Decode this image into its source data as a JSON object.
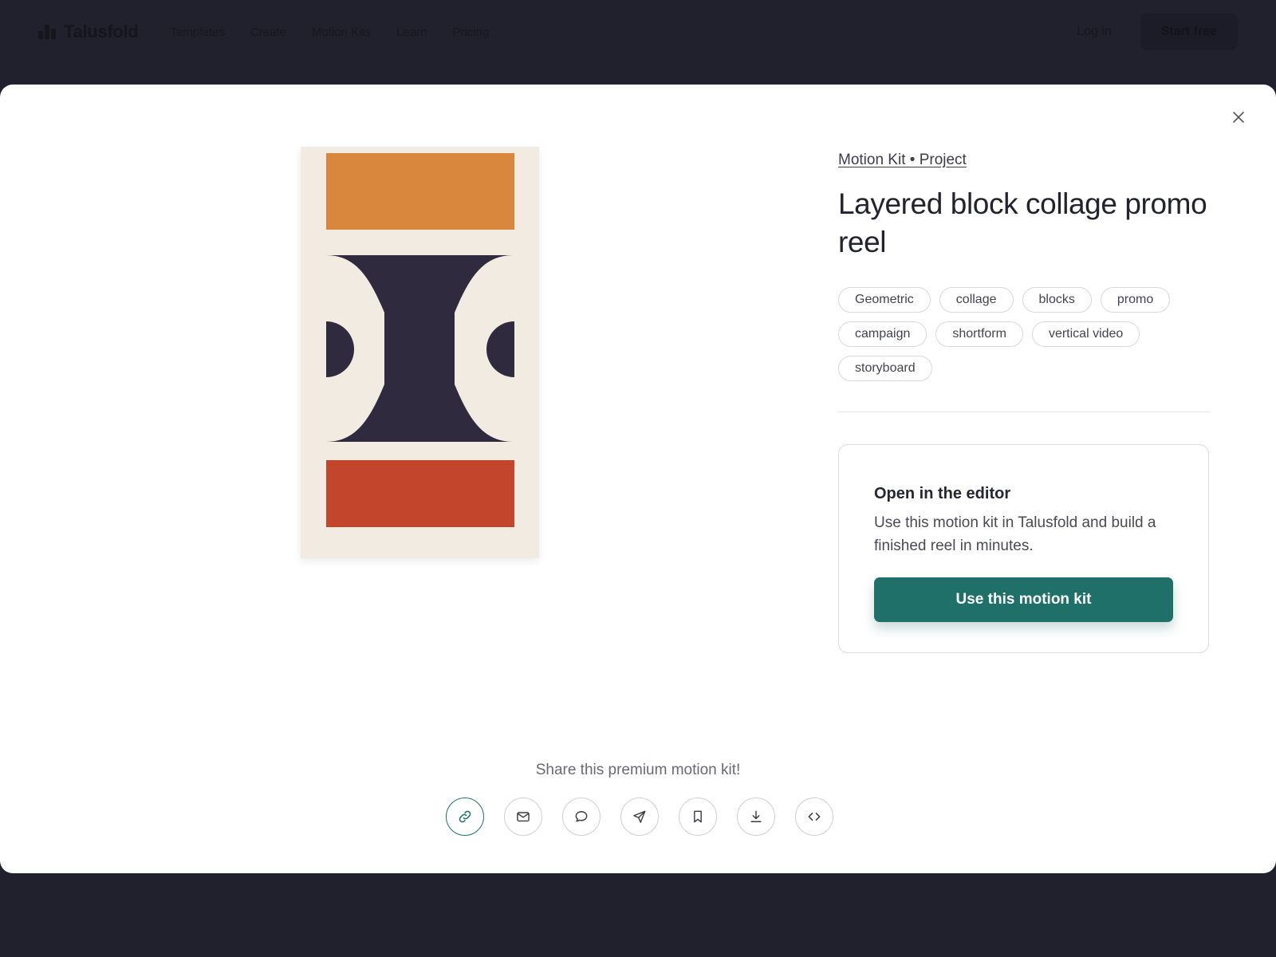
{
  "nav": {
    "brand": "Talusfold",
    "links": [
      "Templates",
      "Create",
      "Motion Kits",
      "Learn",
      "Pricing"
    ],
    "login": "Log in",
    "start": "Start free"
  },
  "modal": {
    "breadcrumb": "Motion Kit • Project",
    "title": "Layered block collage promo reel",
    "tags": [
      "Geometric",
      "collage",
      "blocks",
      "promo",
      "campaign",
      "shortform",
      "vertical video",
      "storyboard"
    ],
    "editor": {
      "heading": "Open in the editor",
      "description": "Use this motion kit in Talusfold and build a finished reel in minutes.",
      "button": "Use this motion kit"
    },
    "share": {
      "label": "Share this premium motion kit!",
      "buttons": [
        {
          "icon": "link-icon",
          "active": true
        },
        {
          "icon": "mail-icon",
          "active": false
        },
        {
          "icon": "chat-bubble-icon",
          "active": false
        },
        {
          "icon": "send-icon",
          "active": false
        },
        {
          "icon": "bookmark-icon",
          "active": false
        },
        {
          "icon": "download-icon",
          "active": false
        },
        {
          "icon": "code-icon",
          "active": false
        }
      ]
    }
  },
  "colors": {
    "accent": "#1f7069",
    "preview_bg": "#f2ebe1",
    "block_orange": "#d8873c",
    "block_navy": "#302a3e",
    "block_red": "#c3462c"
  }
}
